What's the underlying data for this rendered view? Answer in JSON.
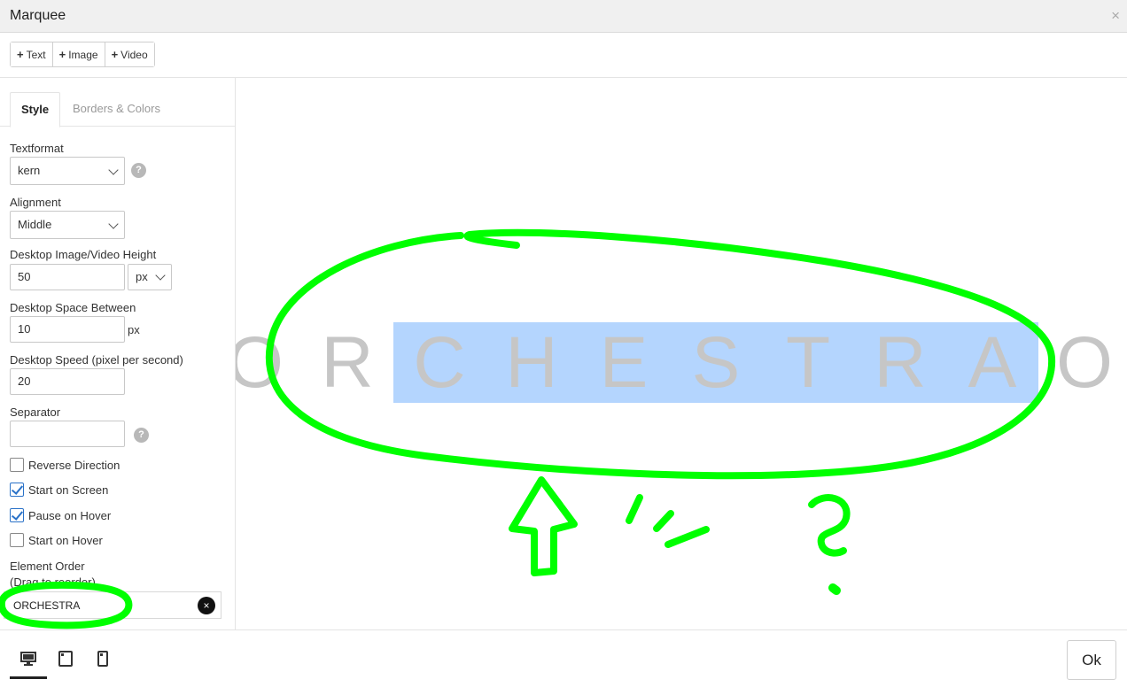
{
  "window": {
    "title": "Marquee",
    "close_label": "×"
  },
  "toolbar": {
    "buttons": [
      {
        "label": "Text"
      },
      {
        "label": "Image"
      },
      {
        "label": "Video"
      }
    ]
  },
  "tabs": [
    {
      "label": "Style",
      "active": true
    },
    {
      "label": "Borders & Colors",
      "active": false
    }
  ],
  "form": {
    "textformat": {
      "label": "Textformat",
      "value": "kern"
    },
    "alignment": {
      "label": "Alignment",
      "value": "Middle"
    },
    "height": {
      "label": "Desktop Image/Video Height",
      "value": "50",
      "unit": "px"
    },
    "space": {
      "label": "Desktop Space Between",
      "value": "10",
      "unit": "px"
    },
    "speed": {
      "label": "Desktop Speed (pixel per second)",
      "value": "20"
    },
    "separator": {
      "label": "Separator",
      "value": ""
    },
    "help_glyph": "?",
    "checkboxes": [
      {
        "label": "Reverse Direction",
        "checked": false
      },
      {
        "label": "Start on Screen",
        "checked": true
      },
      {
        "label": "Pause on Hover",
        "checked": true
      },
      {
        "label": "Start on Hover",
        "checked": false
      }
    ],
    "element_order": {
      "label": "Element Order",
      "sublabel": "(Drag to reorder)",
      "items": [
        "ORCHESTRA"
      ],
      "remove_glyph": "×"
    }
  },
  "preview": {
    "letters": [
      "O",
      "R",
      "C",
      "H",
      "E",
      "S",
      "T",
      "R",
      "A",
      "O"
    ],
    "selected_letters": "CHESTRA",
    "text_color": "#c6c6c6",
    "selection_color": "#b4d5fe"
  },
  "annotation": {
    "color": "#00ff00",
    "mark": "?"
  },
  "footer": {
    "devices": [
      "desktop-icon",
      "tablet-icon",
      "mobile-icon"
    ],
    "active_device": "desktop",
    "ok_label": "Ok"
  }
}
